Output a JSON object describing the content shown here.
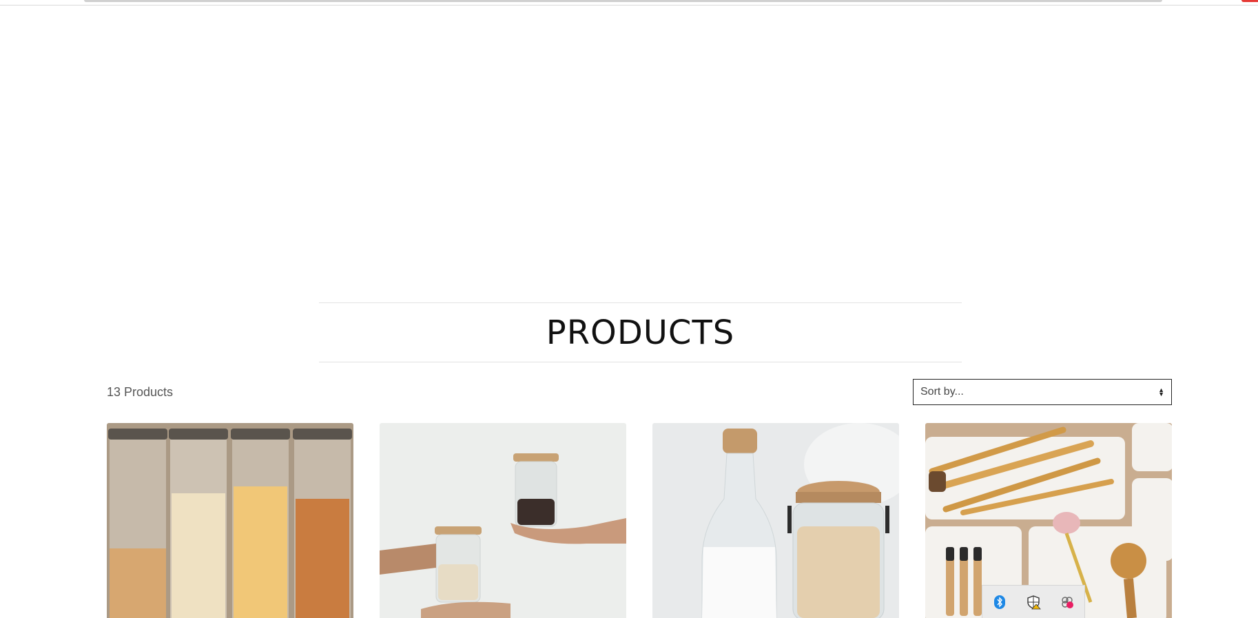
{
  "page": {
    "heading": "PRODUCTS"
  },
  "toolbar": {
    "product_count": "13 Products",
    "sort_placeholder": "Sort by..."
  },
  "products": [
    {
      "image_icon": "pasta-jars-image"
    },
    {
      "image_icon": "oat-jars-hands-image"
    },
    {
      "image_icon": "milk-bottle-oats-jar-image"
    },
    {
      "image_icon": "bamboo-brushes-organizer-image"
    }
  ],
  "tray": {
    "icons": [
      "bluetooth-icon",
      "security-shield-warning-icon",
      "app-status-icon"
    ]
  },
  "colors": {
    "accent_red": "#e53935",
    "border": "#222222",
    "divider": "#e2e2e2"
  }
}
